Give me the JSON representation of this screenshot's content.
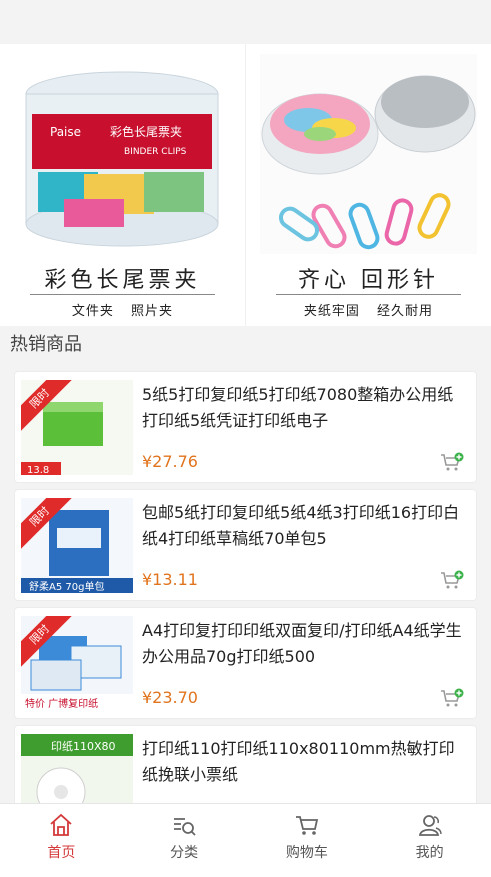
{
  "banners": [
    {
      "title": "彩色长尾票夹",
      "subtitle": "文件夹 照片夹",
      "brand": "Paise",
      "product_label": "彩色长尾票夹",
      "product_label_en": "BINDER CLIPS"
    },
    {
      "title": "齐心 回形针",
      "subtitle": "夹纸牢固 经久耐用"
    }
  ],
  "section": {
    "title": "热销商品"
  },
  "products": [
    {
      "title": "5纸5打印复印纸5打印纸7080整箱办公用纸打印纸5纸凭证打印纸电子",
      "price": "¥27.76",
      "ribbon": "限时",
      "badge_price": "13.8"
    },
    {
      "title": "包邮5纸打印复印纸5纸4纸3打印纸16打印白纸4打印纸草稿纸70单包5",
      "price": "¥13.11",
      "ribbon": "限时",
      "badge": "舒柔A5 70g单包"
    },
    {
      "title": "A4打印复打印印纸双面复印/打印纸A4纸学生办公用品70g打印纸500",
      "price": "¥23.70",
      "ribbon": "限时",
      "badge": "特价 广博复印纸"
    },
    {
      "title": "打印纸110打印纸110x80110mm热敏打印纸挽联小票纸",
      "price": "",
      "ribbon": "",
      "badge": "印纸110X80"
    }
  ],
  "tabbar": [
    {
      "label": "首页",
      "icon": "home-icon",
      "active": true
    },
    {
      "label": "分类",
      "icon": "category-icon",
      "active": false
    },
    {
      "label": "购物车",
      "icon": "cart-icon",
      "active": false
    },
    {
      "label": "我的",
      "icon": "user-icon",
      "active": false
    }
  ],
  "colors": {
    "accent": "#d43a3a",
    "price": "#e0741e",
    "cart_icon_plus": "#3cb34a"
  }
}
